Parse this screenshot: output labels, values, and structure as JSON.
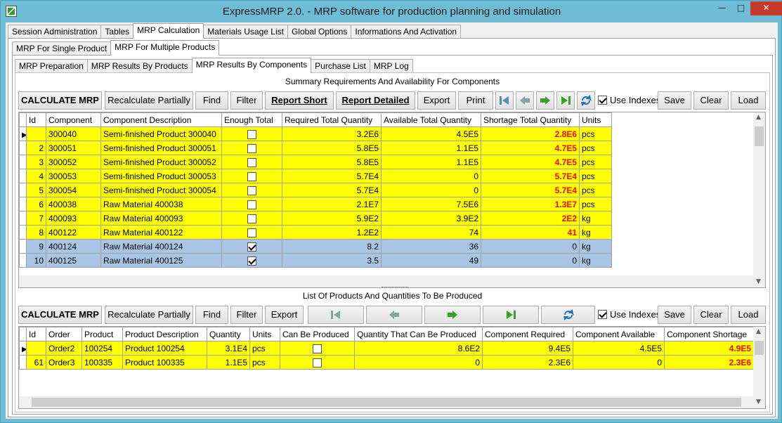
{
  "window": {
    "title": "ExpressMRP 2.0. - MRP software for production planning and simulation"
  },
  "main_tabs": [
    "Session Administration",
    "Tables",
    "MRP Calculation",
    "Materials Usage List",
    "Global Options",
    "Informations And Activation"
  ],
  "sub_tabs": [
    "MRP For Single Product",
    "MRP For Multiple Products"
  ],
  "result_tabs": [
    "MRP Preparation",
    "MRP Results By Products",
    "MRP Results By Components",
    "Purchase List",
    "MRP Log"
  ],
  "top": {
    "caption": "Summary Requirements And Availability For Components",
    "toolbar": {
      "calculate": "CALCULATE MRP",
      "recalc": "Recalculate Partially",
      "find": "Find",
      "filter": "Filter",
      "report_short": "Report Short",
      "report_detailed": "Report Detailed",
      "export": "Export",
      "print": "Print",
      "use_indexes": "Use Indexes",
      "save": "Save",
      "clear": "Clear",
      "load": "Load"
    },
    "columns": [
      "Id",
      "Component",
      "Component Description",
      "Enough Total",
      "Required Total Quantity",
      "Available Total Quantity",
      "Shortage Total Quantity",
      "Units"
    ],
    "rows": [
      {
        "id": "",
        "component": "300040",
        "desc": "Semi-finished Product 300040",
        "enough": false,
        "required": "3.2E6",
        "available": "4.5E5",
        "shortage": "2.8E6",
        "units": "pcs",
        "color": "yellow"
      },
      {
        "id": "2",
        "component": "300051",
        "desc": "Semi-finished Product 300051",
        "enough": false,
        "required": "5.8E5",
        "available": "1.1E5",
        "shortage": "4.7E5",
        "units": "pcs",
        "color": "yellow"
      },
      {
        "id": "3",
        "component": "300052",
        "desc": "Semi-finished Product 300052",
        "enough": false,
        "required": "5.8E5",
        "available": "1.1E5",
        "shortage": "4.7E5",
        "units": "pcs",
        "color": "yellow"
      },
      {
        "id": "4",
        "component": "300053",
        "desc": "Semi-finished Product 300053",
        "enough": false,
        "required": "5.7E4",
        "available": "0",
        "shortage": "5.7E4",
        "units": "pcs",
        "color": "yellow"
      },
      {
        "id": "5",
        "component": "300054",
        "desc": "Semi-finished Product 300054",
        "enough": false,
        "required": "5.7E4",
        "available": "0",
        "shortage": "5.7E4",
        "units": "pcs",
        "color": "yellow"
      },
      {
        "id": "6",
        "component": "400038",
        "desc": "Raw Material 400038",
        "enough": false,
        "required": "2.1E7",
        "available": "7.5E6",
        "shortage": "1.3E7",
        "units": "pcs",
        "color": "yellow"
      },
      {
        "id": "7",
        "component": "400093",
        "desc": "Raw Material 400093",
        "enough": false,
        "required": "5.9E2",
        "available": "3.9E2",
        "shortage": "2E2",
        "units": "kg",
        "color": "yellow"
      },
      {
        "id": "8",
        "component": "400122",
        "desc": "Raw Material 400122",
        "enough": false,
        "required": "1.2E2",
        "available": "74",
        "shortage": "41",
        "units": "kg",
        "color": "yellow"
      },
      {
        "id": "9",
        "component": "400124",
        "desc": "Raw Material 400124",
        "enough": true,
        "required": "8.2",
        "available": "36",
        "shortage": "0",
        "units": "kg",
        "color": "blue"
      },
      {
        "id": "10",
        "component": "400125",
        "desc": "Raw Material 400125",
        "enough": true,
        "required": "3.5",
        "available": "49",
        "shortage": "0",
        "units": "kg",
        "color": "blue"
      }
    ]
  },
  "bottom": {
    "caption": "List Of Products And Quantities To Be Produced",
    "toolbar": {
      "calculate": "CALCULATE MRP",
      "recalc": "Recalculate Partially",
      "find": "Find",
      "filter": "Filter",
      "export": "Export",
      "use_indexes": "Use Indexes",
      "save": "Save",
      "clear": "Clear",
      "load": "Load"
    },
    "columns": [
      "Id",
      "Order",
      "Product",
      "Product Description",
      "Quantity",
      "Units",
      "Can Be Produced",
      "Quantity That Can Be Produced",
      "Component Required",
      "Component Available",
      "Component Shortage"
    ],
    "rows": [
      {
        "id": "",
        "order": "Order2",
        "product": "100254",
        "desc": "Product 100254",
        "quantity": "3.1E4",
        "units": "pcs",
        "can": false,
        "qcan": "8.6E2",
        "required": "9.4E5",
        "available": "4.5E5",
        "shortage": "4.9E5"
      },
      {
        "id": "61",
        "order": "Order3",
        "product": "100335",
        "desc": "Product 100335",
        "quantity": "1.1E5",
        "units": "pcs",
        "can": false,
        "qcan": "0",
        "required": "2.3E6",
        "available": "0",
        "shortage": "2.3E6"
      }
    ]
  },
  "colors": {
    "title_bar": "#6fbcd6",
    "highlight_yellow": "#ffff00",
    "highlight_blue": "#a9c5e6",
    "shortage_red": "#ff0000"
  },
  "icons": [
    "first-icon",
    "previous-icon",
    "next-icon",
    "last-icon",
    "refresh-icon"
  ]
}
